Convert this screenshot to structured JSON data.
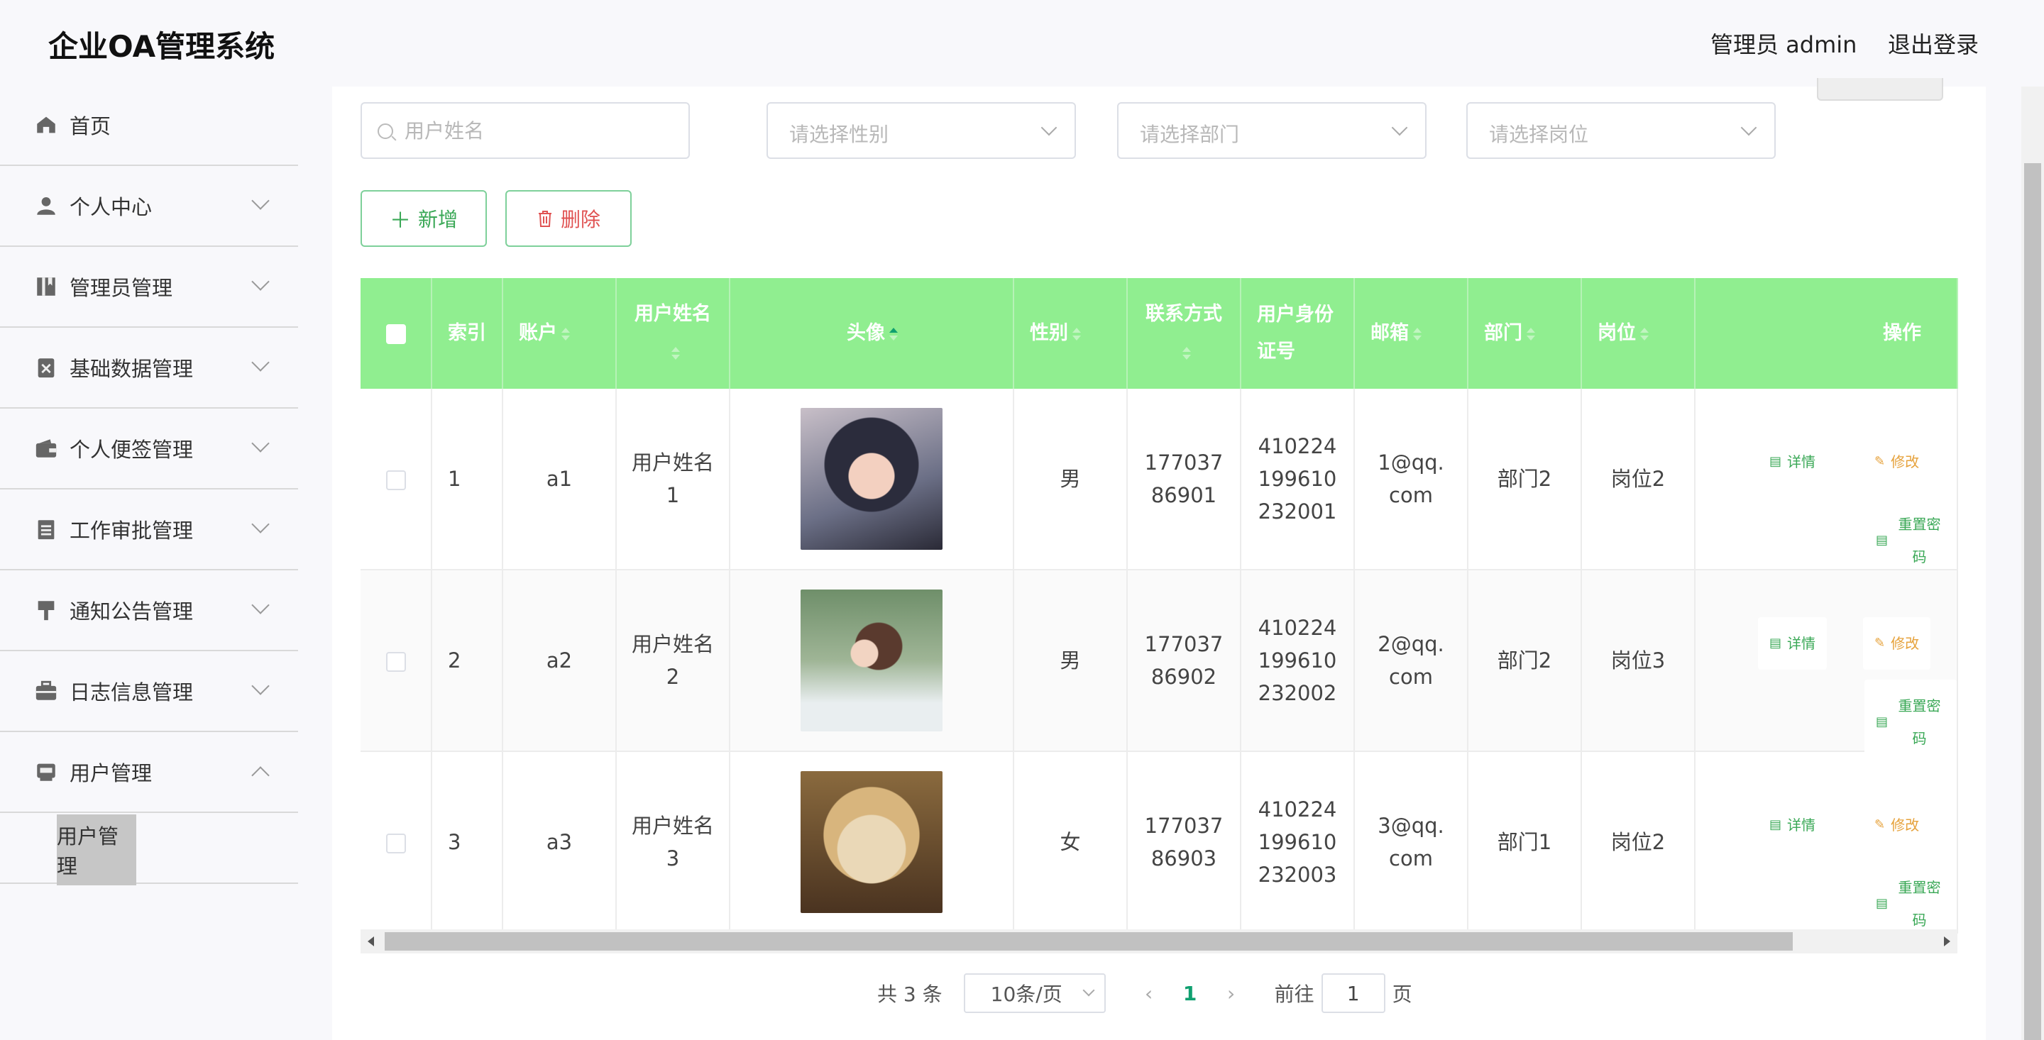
{
  "header": {
    "app_title": "企业OA管理系统",
    "user_info": "管理员 admin",
    "logout": "退出登录"
  },
  "sidebar": {
    "items": [
      {
        "label": "首页",
        "icon": "home-icon"
      },
      {
        "label": "个人中心",
        "icon": "person-icon"
      },
      {
        "label": "管理员管理",
        "icon": "book-icon"
      },
      {
        "label": "基础数据管理",
        "icon": "clipboard-x-icon"
      },
      {
        "label": "个人便签管理",
        "icon": "wallet-icon"
      },
      {
        "label": "工作审批管理",
        "icon": "document-icon"
      },
      {
        "label": "通知公告管理",
        "icon": "brush-icon"
      },
      {
        "label": "日志信息管理",
        "icon": "briefcase-icon"
      },
      {
        "label": "用户管理",
        "icon": "inbox-icon"
      }
    ],
    "active_sub": "用户管理"
  },
  "filters": {
    "name_placeholder": "用户姓名",
    "gender_placeholder": "请选择性别",
    "dept_placeholder": "请选择部门",
    "post_placeholder": "请选择岗位"
  },
  "actions": {
    "add": "新增",
    "delete": "删除"
  },
  "table": {
    "headers": {
      "index": "索引",
      "account": "账户",
      "name": "用户姓名",
      "avatar": "头像",
      "gender": "性别",
      "phone": "联系方式",
      "idcard": "用户身份证号",
      "email": "邮箱",
      "dept": "部门",
      "post": "岗位",
      "ops": "操作"
    },
    "rows": [
      {
        "index": "1",
        "account": "a1",
        "name": "用户姓名1",
        "avatar": "avatar-girl-dark-hair",
        "gender": "男",
        "phone": "17703786901",
        "idcard": "410224199610232001",
        "email": "1@qq.com",
        "dept": "部门2",
        "post": "岗位2"
      },
      {
        "index": "2",
        "account": "a2",
        "name": "用户姓名2",
        "avatar": "avatar-girl-ponytail",
        "gender": "男",
        "phone": "17703786902",
        "idcard": "410224199610232002",
        "email": "2@qq.com",
        "dept": "部门2",
        "post": "岗位3"
      },
      {
        "index": "3",
        "account": "a3",
        "name": "用户姓名3",
        "avatar": "avatar-puppy",
        "gender": "女",
        "phone": "17703786903",
        "idcard": "410224199610232003",
        "email": "3@qq.com",
        "dept": "部门1",
        "post": "岗位2"
      }
    ],
    "row_actions": {
      "detail": "详情",
      "edit": "修改",
      "reset": "重置密码"
    }
  },
  "pagination": {
    "total": "共 3 条",
    "page_size": "10条/页",
    "current_page": "1",
    "goto_label": "前往",
    "goto_value": "1",
    "page_suffix": "页"
  },
  "colors": {
    "header_green": "#90ee90",
    "accent_green": "#10a070",
    "danger": "#e05353",
    "warning": "#e6a23c"
  }
}
